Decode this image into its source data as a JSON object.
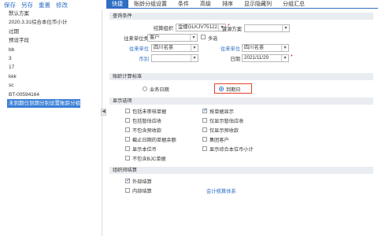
{
  "toolbar": {
    "save": "保存",
    "save_as": "另存",
    "rename": "重置",
    "modify": "修改"
  },
  "left_list": {
    "items": [
      "默认方案",
      "2020.3.31综合本位币小计",
      "过期",
      "预设字段",
      "bb",
      "3",
      "17",
      "kkk",
      "sc",
      "BT-00594164"
    ],
    "selected": "未到期日到期分别设置账龄分组"
  },
  "tabs": [
    "快捷",
    "账龄分组设置",
    "条件",
    "高级",
    "排序",
    "显示隐藏列",
    "分组汇总"
  ],
  "query": {
    "section": "查询条件",
    "settle_org_label": "结算组织",
    "settle_org_value": "金蝶GLKJV75122...",
    "contact_type_label": "往来单位类型",
    "contact_type_value": "客户",
    "multi_select": "多选",
    "contact_from_label": "往来单位",
    "contact_from_value": "四川名茶",
    "currency_label": "币别",
    "currency_value": "",
    "resource_label": "资源方案",
    "resource_value": "",
    "contact_to_label": "往来单位",
    "contact_to_value": "四川名茶",
    "date_label": "日期",
    "date_value": "2021/11/29"
  },
  "aging": {
    "section": "账龄计算标准",
    "opt_business": "业务日期",
    "opt_due": "到期日"
  },
  "display": {
    "section": "显示选项",
    "left": [
      "包括未审核单据",
      "包括暂估应收",
      "不包含预收款",
      "截止日期的单据余额",
      "显示本位币",
      "不包含BJC单据"
    ],
    "right": [
      "按单据显示",
      "仅显示暂估应收",
      "仅显示预收款",
      "集团客户",
      "显示综合本位币小计"
    ],
    "right_checked": [
      true,
      false,
      false,
      false,
      false
    ]
  },
  "internal": {
    "section": "组织间结算",
    "items": [
      "外部结算",
      "内部结算"
    ],
    "checked": [
      true,
      false
    ],
    "link": "会计核算体系"
  },
  "colors": {
    "accent": "#2f6fc4",
    "selected_bg": "#3a7fd6",
    "highlight": "#e0432a"
  }
}
